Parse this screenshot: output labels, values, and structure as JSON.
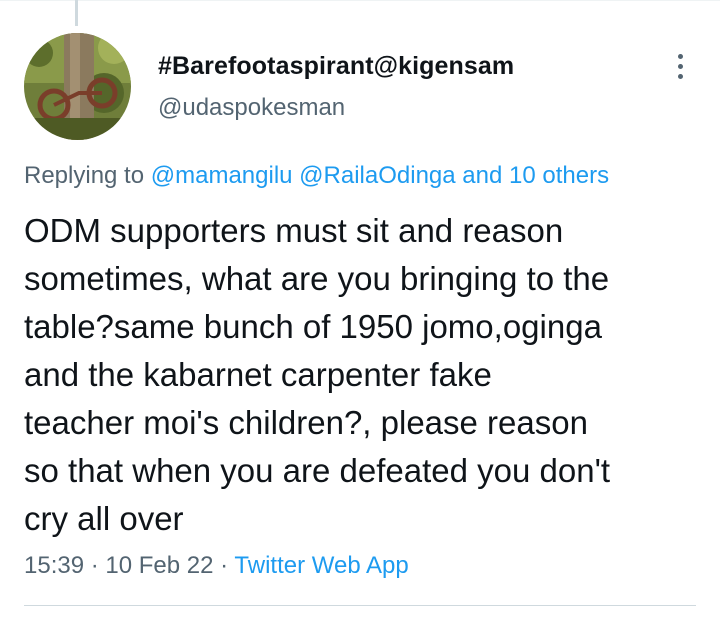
{
  "author": {
    "display_name": "#Barefootaspirant@kigensam",
    "handle": "@udaspokesman"
  },
  "reply": {
    "prefix": "Replying to",
    "mentions": [
      "@mamangilu",
      "@RailaOdinga"
    ],
    "others": "and 10 others"
  },
  "tweet": {
    "text": "ODM supporters must sit and reason\nsometimes, what are you bringing to the\ntable?same bunch of 1950 jomo,oginga\nand the kabarnet carpenter  fake\nteacher moi's children?, please reason\nso that when you are defeated you don't\ncry all over"
  },
  "meta": {
    "time": "15:39",
    "separator": "·",
    "date": "10 Feb 22",
    "source": "Twitter Web App"
  },
  "icons": {
    "more": "more-options-icon",
    "avatar": "profile-photo"
  },
  "colors": {
    "link": "#1d9bf0",
    "secondary_text": "#536471",
    "primary_text": "#0f1419",
    "divider": "#cfd9de"
  }
}
